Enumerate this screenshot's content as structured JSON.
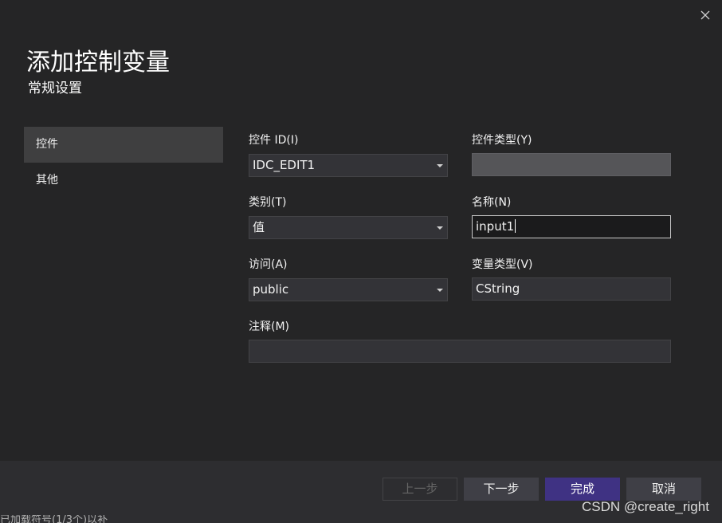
{
  "dialog": {
    "title": "添加控制变量",
    "subtitle": "常规设置"
  },
  "nav": {
    "items": [
      {
        "label": "控件",
        "active": true
      },
      {
        "label": "其他",
        "active": false
      }
    ]
  },
  "form": {
    "control_id": {
      "label": "控件 ID(I)",
      "value": "IDC_EDIT1"
    },
    "control_type": {
      "label": "控件类型(Y)",
      "value": ""
    },
    "category": {
      "label": "类别(T)",
      "value": "值"
    },
    "name": {
      "label": "名称(N)",
      "value": "input1"
    },
    "access": {
      "label": "访问(A)",
      "value": "public"
    },
    "variable_type": {
      "label": "变量类型(V)",
      "value": "CString"
    },
    "comment": {
      "label": "注释(M)",
      "value": ""
    }
  },
  "footer": {
    "back_label": "上一步",
    "next_label": "下一步",
    "finish_label": "完成",
    "cancel_label": "取消"
  },
  "status_fragment": "已加载符号(1/3个)以补",
  "watermark": "CSDN @create_right",
  "icons": {
    "close": "close-icon",
    "dropdown": "chevron-down-icon"
  },
  "colors": {
    "background": "#252526",
    "nav_active": "#3f3f40",
    "primary_button": "#3f3283",
    "input_background": "#333337",
    "footer_background": "#2d2d30"
  }
}
